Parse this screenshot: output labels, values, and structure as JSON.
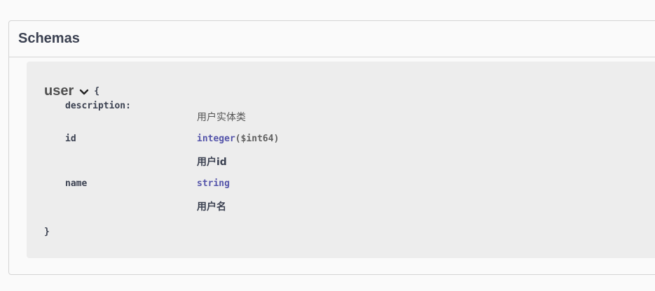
{
  "section": {
    "title": "Schemas"
  },
  "model": {
    "name": "user",
    "open_brace": "{",
    "close_brace": "}",
    "description_key": "description:",
    "description_value": "用户实体类",
    "properties": [
      {
        "name": "id",
        "type": "integer",
        "format": "($int64)",
        "description": "用户id"
      },
      {
        "name": "name",
        "type": "string",
        "format": "",
        "description": "用户名"
      }
    ]
  },
  "colors": {
    "type": "#5555aa",
    "text": "#3b4151",
    "panel": "#ededed",
    "border": "#d4d4d4"
  }
}
